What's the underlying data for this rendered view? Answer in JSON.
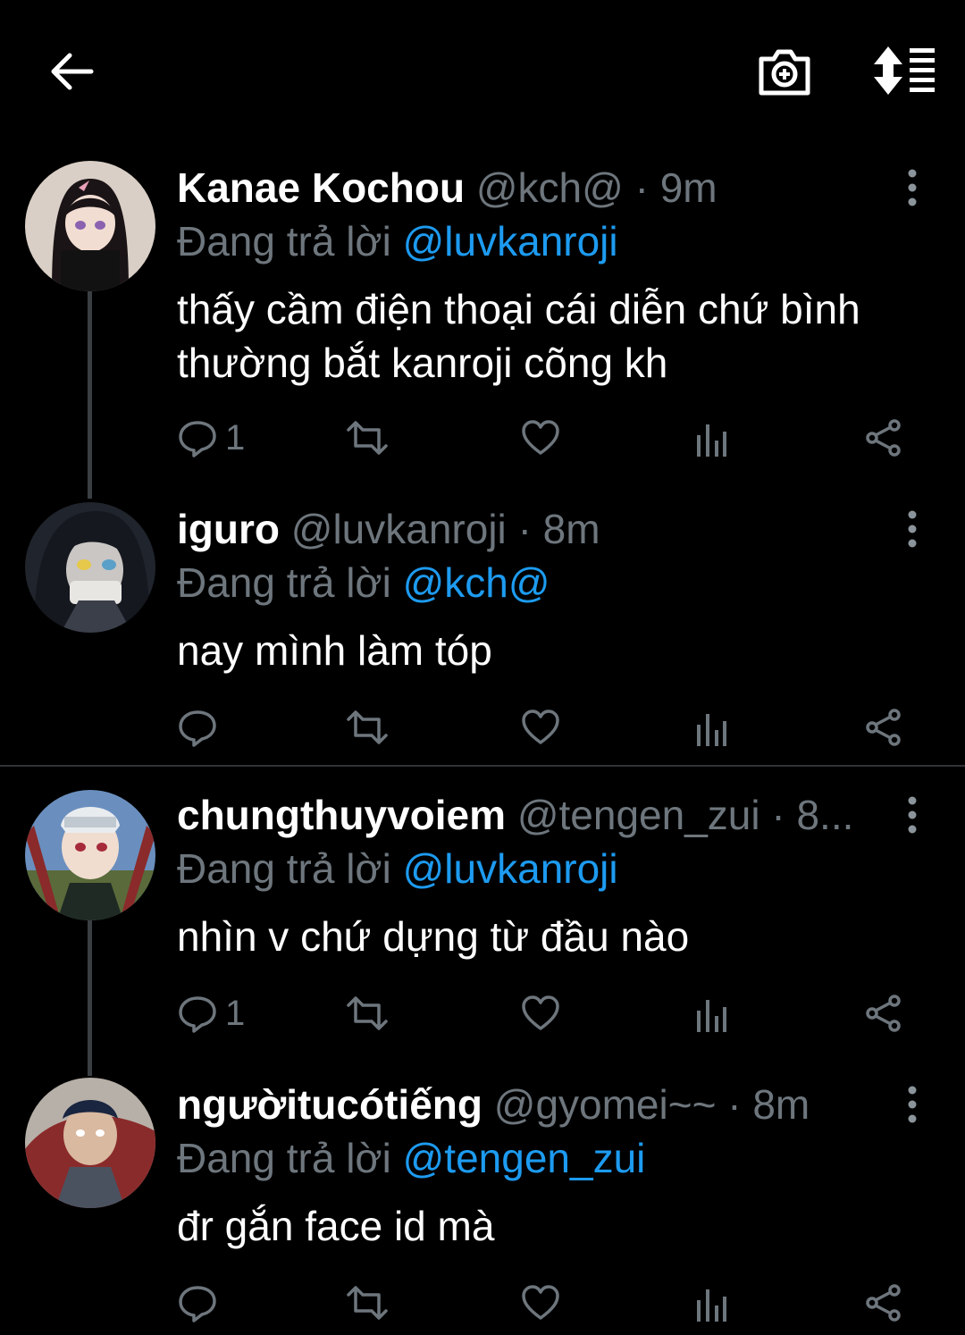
{
  "colors": {
    "background": "#000000",
    "accent": "#1d9bf0",
    "muted": "#6e767d",
    "text": "#ffffff"
  },
  "topbar": {
    "back_icon": "arrow-left-icon",
    "camera_icon": "camera-plus-icon",
    "sort_icon": "sort-list-icon"
  },
  "replying_label": "Đang trả lời",
  "tweets": [
    {
      "name": "Kanae Kochou",
      "handle": "@kch@",
      "time": "· 9m",
      "reply_to": "@luvkanroji",
      "text": "thấy cầm điện thoại cái diễn chứ bình thường bắt kanroji cõng kh",
      "reply_count": "1"
    },
    {
      "name": "iguro",
      "handle": "@luvkanroji",
      "time": "· 8m",
      "reply_to": "@kch@",
      "text": "nay mình làm tóp",
      "reply_count": ""
    },
    {
      "name": "chungthuyvoiem",
      "handle": "@tengen_zui",
      "time": "· 8...",
      "reply_to": "@luvkanroji",
      "text": "nhìn v chứ dựng từ đầu nào",
      "reply_count": "1"
    },
    {
      "name": "ngườitucótiếng",
      "handle": "@gyomei~~",
      "time": "· 8m",
      "reply_to": "@tengen_zui",
      "text": "đr gắn face id mà",
      "reply_count": ""
    }
  ]
}
